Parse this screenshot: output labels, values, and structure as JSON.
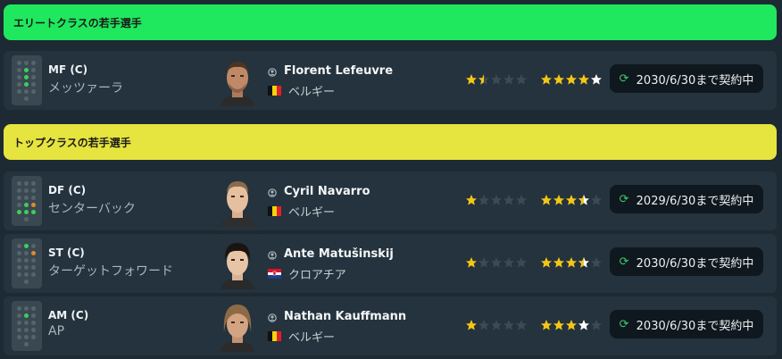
{
  "sections": [
    {
      "title": "エリートクラスの若手選手",
      "color": "#1fe85e"
    },
    {
      "title": "トップクラスの若手選手",
      "color": "#e6e43e"
    }
  ],
  "players": [
    {
      "position": "MF (C)",
      "role": "メッツァーラ",
      "name": "Florent Lefeuvre",
      "nation": "ベルギー",
      "flag": "belgium",
      "current_ability": "1.5/5",
      "potential_ability": "4/5",
      "contract": "2030/6/30まで契約中"
    },
    {
      "position": "DF (C)",
      "role": "センターバック",
      "name": "Cyril Navarro",
      "nation": "ベルギー",
      "flag": "belgium",
      "current_ability": "1/5",
      "potential_ability": "3.5/5",
      "contract": "2029/6/30まで契約中"
    },
    {
      "position": "ST (C)",
      "role": "ターゲットフォワード",
      "name": "Ante Matušinskij",
      "nation": "クロアチア",
      "flag": "croatia",
      "current_ability": "1/5",
      "potential_ability": "3.5/5",
      "contract": "2030/6/30まで契約中"
    },
    {
      "position": "AM (C)",
      "role": "AP",
      "name": "Nathan Kauffmann",
      "nation": "ベルギー",
      "flag": "belgium",
      "current_ability": "1/5",
      "potential_ability": "3/5",
      "contract": "2030/6/30まで契約中"
    }
  ],
  "icons": {
    "person": "person-icon",
    "renew": "renew-icon",
    "star": "star-icon"
  },
  "colors": {
    "star_gold": "#f5c518",
    "star_empty": "#3d4a53",
    "star_white": "#ffffff"
  }
}
